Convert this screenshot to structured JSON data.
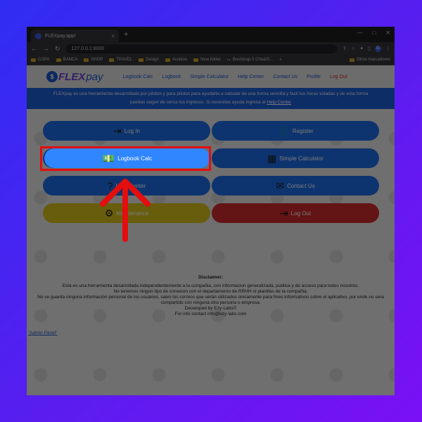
{
  "browser": {
    "tab_title": "FLEXpay.app!",
    "tab_close": "×",
    "new_tab": "+",
    "window_controls": [
      "—",
      "□",
      "✕"
    ],
    "url": "127.0.0.1:8000",
    "nav_icons": [
      "arrow-left-icon",
      "arrow-right-icon",
      "reload-icon"
    ],
    "profile_initial": "G",
    "bookmarks": [
      "COPA",
      "BANCA",
      "SHOP",
      "TRAVEL",
      "Design",
      "Aviation",
      "New folder",
      "Bootstrap 5 CheatS..."
    ],
    "other_bookmarks": "Otros marcadores",
    "bookmark_overflow": "»"
  },
  "site": {
    "logo_mark": "$",
    "logo_flex": "FLEX",
    "logo_pay": "pay",
    "nav": [
      "Logbook Calc",
      "Logbook",
      "Simple Calculator",
      "Help Center",
      "Contact Us",
      "Profile",
      "Log Out"
    ],
    "banner_text": "FLEXpay es una herramienta desarrollada por pilotos y para pilotos para ayudarte a calcular de una forma sencilla y facil tus horas voladas y de esta forma puedas seguir de cerca tus ingresos. Si necesitas ayuda ingresa al",
    "banner_link": "Help Center",
    "buttons": [
      {
        "label": "Log In",
        "icon": "login-icon",
        "glyph": "⇥",
        "color": "blue"
      },
      {
        "label": "Register",
        "icon": "add-user-icon",
        "glyph": "👤",
        "color": "blue"
      },
      {
        "label": "Logbook Calc",
        "icon": "money-icon",
        "glyph": "💵",
        "color": "blue"
      },
      {
        "label": "Simple Calculator",
        "icon": "calculator-icon",
        "glyph": "▦",
        "color": "blue"
      },
      {
        "label": "Help Center",
        "icon": "question-icon",
        "glyph": "?",
        "color": "blue"
      },
      {
        "label": "Contact Us",
        "icon": "mail-icon",
        "glyph": "✉",
        "color": "blue"
      },
      {
        "label": "Maintenance",
        "icon": "gear-icon",
        "glyph": "⚙",
        "color": "yellow"
      },
      {
        "label": "Log Out",
        "icon": "logout-icon",
        "glyph": "⇥",
        "color": "red"
      }
    ],
    "disclaimer_title": "Disclaimer:",
    "disclaimer_lines": [
      "Esta es una herramienta desarrollada independientemente a la compañia, con informacion generalizada, publica y de acceso para todos nosotros.",
      "No tenemos ningun tipo de conexion con el departamento de RRHH ni planillas de la compañia.",
      "No se guarda ninguna información personal de los usuarios, salvo los correos que serán utilizados únicamente para fines informativos sobre el aplicativo, por ende no sera compartido con ninguna otra persona o empresa.",
      "Developed by Ezy-Labs©",
      "For info contact info@ezy-labs.com"
    ],
    "admin_link": "\"Admin Panel\""
  },
  "colors": {
    "highlight_box": "#e30e0e",
    "arrow": "#e30e0e",
    "button_blue": "#1f6ee8",
    "button_yellow": "#d9c21b",
    "button_red": "#cf2a2a",
    "banner": "#1d5fd6"
  }
}
